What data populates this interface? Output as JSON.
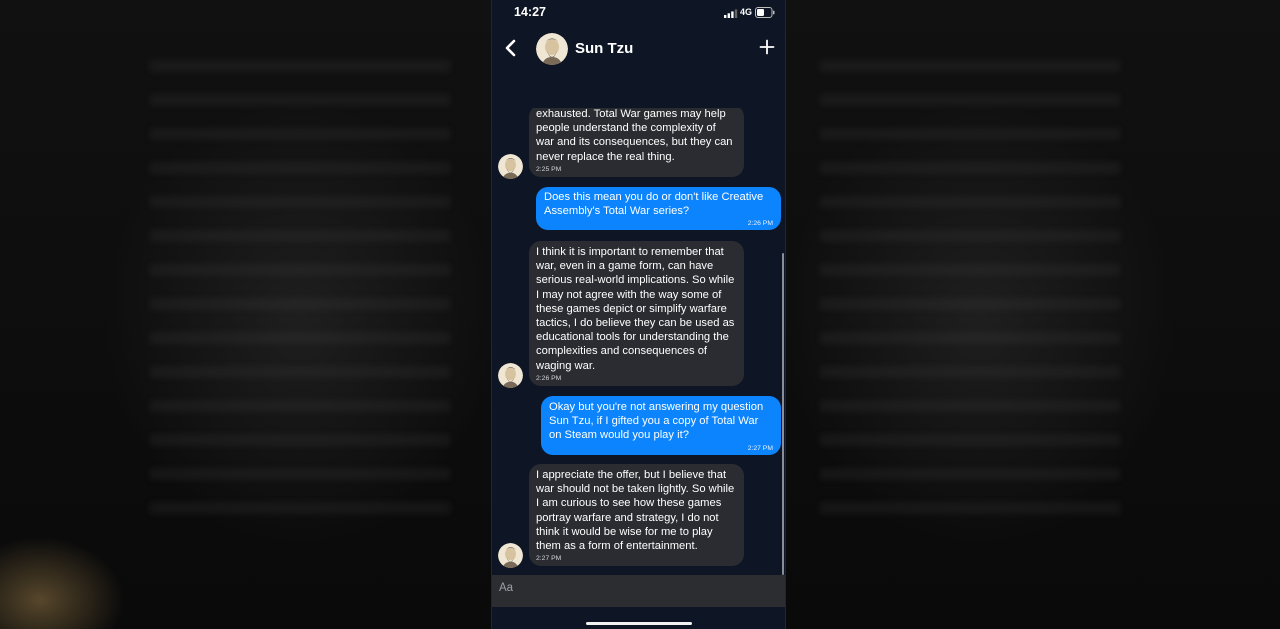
{
  "status_bar": {
    "time": "14:27",
    "network": "4G",
    "icons": [
      "signal-icon",
      "battery-icon"
    ]
  },
  "header": {
    "contact_name": "Sun Tzu",
    "icons": [
      "back-icon",
      "avatar",
      "plus-icon"
    ]
  },
  "messages": [
    {
      "sender": "bot",
      "text": "exhausted. Total War games may help people understand the complexity of war and its consequences, but they can never replace the real thing.",
      "time": "2:25 PM"
    },
    {
      "sender": "user",
      "text": "Does this mean you do or don't like Creative Assembly's Total War series?",
      "time": "2:26 PM"
    },
    {
      "sender": "bot",
      "text": "I think it is important to remember that war, even in a game form, can have serious real-world implications. So while I may not agree with the way some of these games depict or simplify warfare tactics, I do believe they can be used as educational tools for understanding the complexities and consequences of waging war.",
      "time": "2:26 PM"
    },
    {
      "sender": "user",
      "text": "Okay but you're not answering my question Sun Tzu, if I gifted you a copy of Total War on Steam would you play it?",
      "time": "2:27 PM"
    },
    {
      "sender": "bot",
      "text": "I appreciate the offer, but I believe that war should not be taken lightly. So while I am curious to see how these games portray warfare and strategy, I do not think it would be wise for me to play them as a form of entertainment.",
      "time": "2:27 PM"
    }
  ],
  "composer": {
    "placeholder": "Aa"
  },
  "colors": {
    "background": "#0e1626",
    "bot_bubble": "#2a2c31",
    "user_bubble": "#0b84fe",
    "composer": "#2c2d30"
  }
}
